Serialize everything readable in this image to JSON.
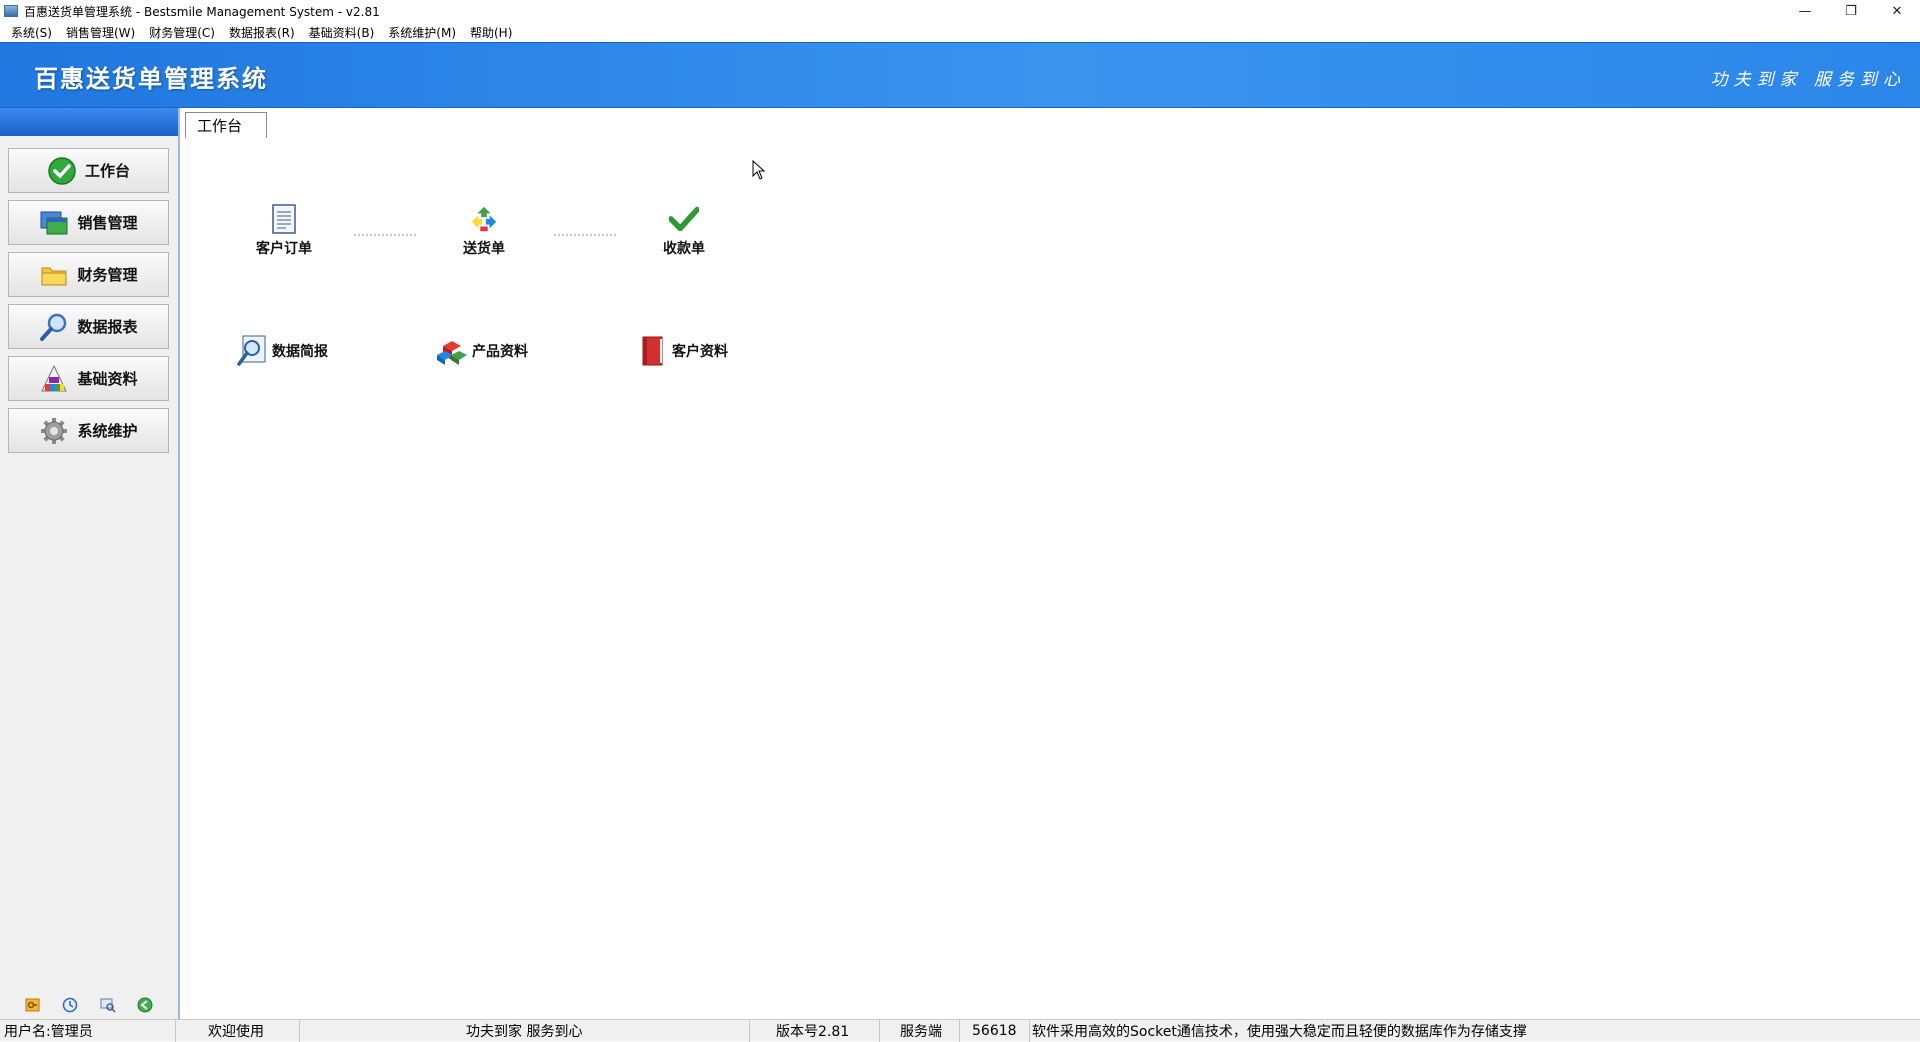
{
  "window": {
    "title": "百惠送货单管理系统 - Bestsmile Management System - v2.81",
    "controls": {
      "minimize": "—",
      "restore": "❐",
      "close": "✕"
    }
  },
  "menu": [
    "系统(S)",
    "销售管理(W)",
    "财务管理(C)",
    "数据报表(R)",
    "基础资料(B)",
    "系统维护(M)",
    "帮助(H)"
  ],
  "banner": {
    "brand": "百惠送货单管理系统",
    "slogan": "功夫到家 服务到心"
  },
  "sidebar": {
    "items": [
      {
        "label": "工作台",
        "icon": "check-circle-icon"
      },
      {
        "label": "销售管理",
        "icon": "windows-icon"
      },
      {
        "label": "财务管理",
        "icon": "folder-icon"
      },
      {
        "label": "数据报表",
        "icon": "magnifier-icon"
      },
      {
        "label": "基础资料",
        "icon": "palette-icon"
      },
      {
        "label": "系统维护",
        "icon": "gear-icon"
      }
    ],
    "tools": [
      "key-icon",
      "clock-icon",
      "search-icon",
      "back-icon"
    ]
  },
  "content": {
    "tab": "工作台",
    "flow": [
      {
        "label": "客户订单",
        "icon": "document-icon"
      },
      {
        "label": "送货单",
        "icon": "recycle-icon"
      },
      {
        "label": "收款单",
        "icon": "checkmark-icon"
      }
    ],
    "quick": [
      {
        "label": "数据简报",
        "icon": "report-magnifier-icon"
      },
      {
        "label": "产品资料",
        "icon": "cubes-icon"
      },
      {
        "label": "客户资料",
        "icon": "red-book-icon"
      }
    ]
  },
  "status": {
    "user": "用户名:管理员",
    "welcome": "欢迎使用",
    "slogan": "功夫到家 服务到心",
    "version": "版本号2.81",
    "server_label": "服务端",
    "port": "56618",
    "message": "软件采用高效的Socket通信技术，使用强大稳定而且轻便的数据库作为存储支撑"
  },
  "colors": {
    "banner": "#2b86ea",
    "sidebar_bg": "#f0f0f0"
  }
}
